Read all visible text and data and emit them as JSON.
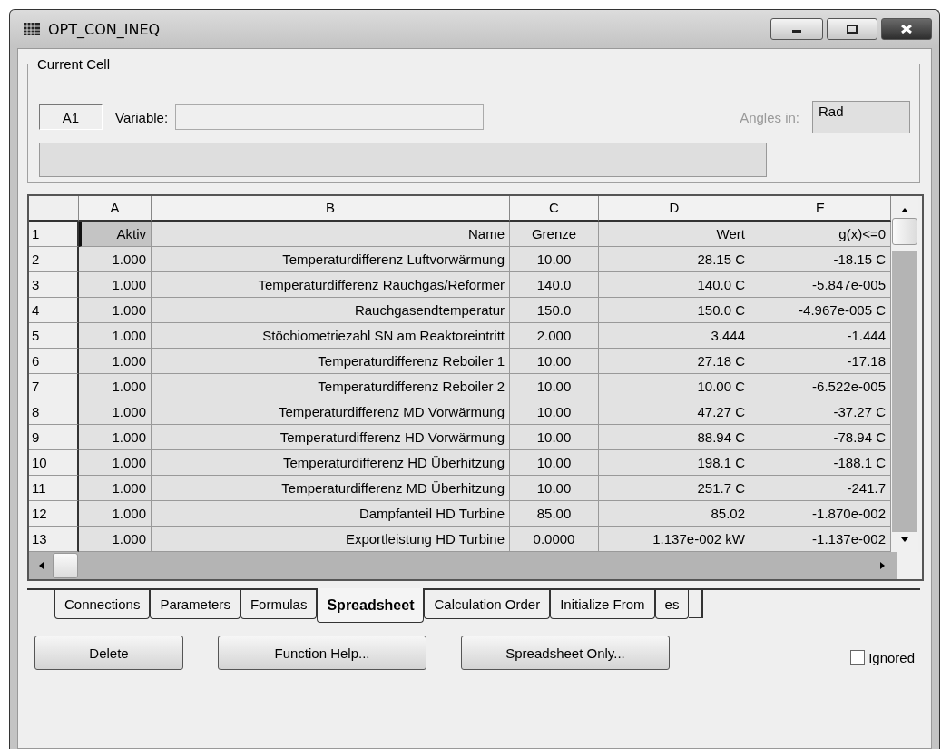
{
  "window": {
    "title": "OPT_CON_INEQ"
  },
  "current_cell": {
    "legend": "Current Cell",
    "cell": "A1",
    "variable_label": "Variable:",
    "angles_label": "Angles in:",
    "angles_value": "Rad"
  },
  "table": {
    "columns": [
      "A",
      "B",
      "C",
      "D",
      "E"
    ],
    "rows": [
      {
        "header": "1",
        "selected": true,
        "cells": [
          "Aktiv",
          "Name",
          "Grenze",
          "Wert",
          "g(x)<=0"
        ]
      },
      {
        "header": "2",
        "selected": false,
        "cells": [
          "1.000",
          "Temperaturdifferenz Luftvorwärmung",
          "10.00",
          "28.15 C",
          "-18.15 C"
        ]
      },
      {
        "header": "3",
        "selected": false,
        "cells": [
          "1.000",
          "Temperaturdifferenz Rauchgas/Reformer",
          "140.0",
          "140.0 C",
          "-5.847e-005"
        ]
      },
      {
        "header": "4",
        "selected": false,
        "cells": [
          "1.000",
          "Rauchgasendtemperatur",
          "150.0",
          "150.0 C",
          "-4.967e-005 C"
        ]
      },
      {
        "header": "5",
        "selected": false,
        "cells": [
          "1.000",
          "Stöchiometriezahl SN am Reaktoreintritt",
          "2.000",
          "3.444",
          "-1.444"
        ]
      },
      {
        "header": "6",
        "selected": false,
        "cells": [
          "1.000",
          "Temperaturdifferenz Reboiler 1",
          "10.00",
          "27.18 C",
          "-17.18"
        ]
      },
      {
        "header": "7",
        "selected": false,
        "cells": [
          "1.000",
          "Temperaturdifferenz Reboiler 2",
          "10.00",
          "10.00 C",
          "-6.522e-005"
        ]
      },
      {
        "header": "8",
        "selected": false,
        "cells": [
          "1.000",
          "Temperaturdifferenz MD Vorwärmung",
          "10.00",
          "47.27 C",
          "-37.27 C"
        ]
      },
      {
        "header": "9",
        "selected": false,
        "cells": [
          "1.000",
          "Temperaturdifferenz HD Vorwärmung",
          "10.00",
          "88.94 C",
          "-78.94 C"
        ]
      },
      {
        "header": "10",
        "selected": false,
        "cells": [
          "1.000",
          "Temperaturdifferenz HD Überhitzung",
          "10.00",
          "198.1 C",
          "-188.1 C"
        ]
      },
      {
        "header": "11",
        "selected": false,
        "cells": [
          "1.000",
          "Temperaturdifferenz MD Überhitzung",
          "10.00",
          "251.7 C",
          "-241.7"
        ]
      },
      {
        "header": "12",
        "selected": false,
        "cells": [
          "1.000",
          "Dampfanteil HD Turbine",
          "85.00",
          "85.02",
          "-1.870e-002"
        ]
      },
      {
        "header": "13",
        "selected": false,
        "cells": [
          "1.000",
          "Exportleistung HD Turbine",
          "0.0000",
          "1.137e-002 kW",
          "-1.137e-002"
        ]
      }
    ]
  },
  "tabs": [
    {
      "label": "Connections",
      "selected": false
    },
    {
      "label": "Parameters",
      "selected": false
    },
    {
      "label": "Formulas",
      "selected": false
    },
    {
      "label": "Spreadsheet",
      "selected": true
    },
    {
      "label": "Calculation Order",
      "selected": false
    },
    {
      "label": "Initialize From",
      "selected": false
    },
    {
      "label": "es",
      "selected": false
    }
  ],
  "buttons": [
    "Delete",
    "Function Help...",
    "Spreadsheet Only..."
  ],
  "ignored": {
    "label": "Ignored",
    "checked": false
  }
}
